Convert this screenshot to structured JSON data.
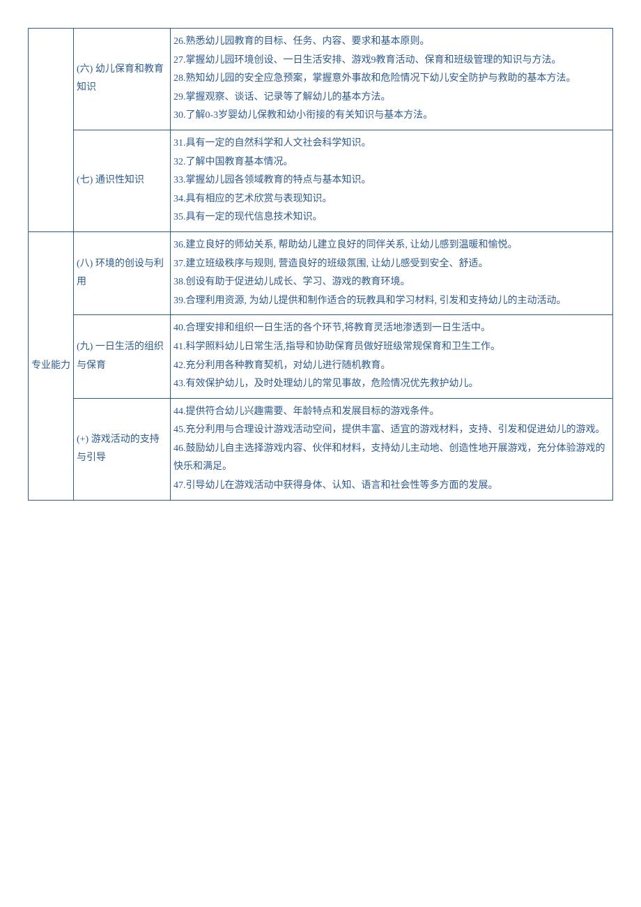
{
  "rows": [
    {
      "col1": "",
      "col2": "(六) 幼儿保育和教育知识",
      "items": [
        "26.熟悉幼儿园教育的目标、任务、内容、要求和基本原则。",
        "27.掌握幼儿园环境创设、一日生活安排、游戏9教育活动、保育和班级管理的知识与方法。",
        "28.熟知幼儿园的安全应急预案，掌握意外事故和危险情况下幼儿安全防护与救助的基本方法。",
        "29.掌握观察、谈话、记录等了解幼儿的基本方法。",
        "30.了解0-3岁婴幼儿保教和幼小衔接的有关知识与基本方法。"
      ],
      "rs1": 2
    },
    {
      "col2": "(七) 通识性知识",
      "items": [
        "31.具有一定的自然科学和人文社会科学知识。",
        "32.了解中国教育基本情况。",
        "33.掌握幼儿园各领域教育的特点与基本知识。",
        "34.具有相应的艺术欣赏与表现知识。",
        "35.具有一定的现代信息技术知识。"
      ]
    },
    {
      "col1": "专业能力",
      "col2": "(八) 环境的创设与利用",
      "items": [
        "36.建立良好的师幼关系, 帮助幼儿建立良好的同伴关系, 让幼儿感到温暖和愉悦。",
        "37.建立班级秩序与规则, 营造良好的班级氛围, 让幼儿感受到安全、舒适。",
        "38.创设有助于促进幼儿成长、学习、游戏的教育环境。",
        "39.合理利用资源, 为幼儿提供和制作适合的玩教具和学习材料, 引发和支持幼儿的主动活动。"
      ],
      "rs1": 3
    },
    {
      "col2": "(九) 一日生活的组织与保育",
      "items": [
        "40.合理安排和组织一日生活的各个环节,将教育灵活地渗透到一日生活中。",
        "41.科学照料幼儿日常生活,指导和协助保育员做好班级常规保育和卫生工作。",
        "42.充分利用各种教育契机，对幼儿进行随机教育。",
        "43.有效保护幼儿，及时处理幼儿的常见事故，危险情况优先救护幼儿。"
      ]
    },
    {
      "col2": "(+) 游戏活动的支持与引导",
      "items": [
        "44.提供符合幼儿兴趣需要、年龄特点和发展目标的游戏条件。",
        "45.充分利用与合理设计游戏活动空间，提供丰富、适宜的游戏材料，支持、引发和促进幼儿的游戏。",
        "46.鼓励幼儿自主选择游戏内容、伙伴和材料，支持幼儿主动地、创造性地开展游戏，充分体验游戏的快乐和满足。",
        "47.引导幼儿在游戏活动中获得身体、认知、语言和社会性等多方面的发展。"
      ]
    }
  ]
}
